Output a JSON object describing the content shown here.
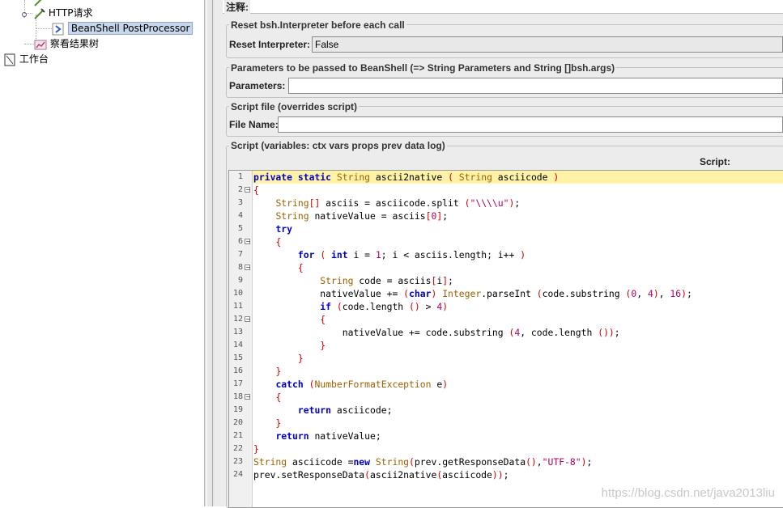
{
  "tree": {
    "items": [
      {
        "label": "HTTP请求"
      },
      {
        "label": "BeanShell PostProcessor",
        "selected": true
      },
      {
        "label": "察看结果树"
      },
      {
        "label": "工作台"
      }
    ]
  },
  "panel": {
    "comments_label": "注释:",
    "reset_section": {
      "legend": "Reset bsh.Interpreter before each call",
      "label": "Reset Interpreter:",
      "value": "False"
    },
    "params_section": {
      "legend": "Parameters to be passed to BeanShell (=> String Parameters and String []bsh.args)",
      "label": "Parameters:",
      "value": ""
    },
    "file_section": {
      "legend": "Script file (overrides script)",
      "label": "File Name:",
      "value": ""
    },
    "script_section": {
      "legend": "Script (variables: ctx vars props prev data log)",
      "script_label": "Script:"
    }
  },
  "script": {
    "lines": [
      "private static String ascii2native ( String asciicode )",
      "{",
      "    String[] asciis = asciicode.split (\"\\\\\\\\u\");",
      "    String nativeValue = asciis[0];",
      "    try",
      "    {",
      "        for ( int i = 1; i < asciis.length; i++ )",
      "        {",
      "            String code = asciis[i];",
      "            nativeValue += (char) Integer.parseInt (code.substring (0, 4), 16);",
      "            if (code.length () > 4)",
      "            {",
      "                nativeValue += code.substring (4, code.length ());",
      "            }",
      "        }",
      "    }",
      "    catch (NumberFormatException e)",
      "    {",
      "        return asciicode;",
      "    }",
      "    return nativeValue;",
      "}",
      "String asciicode =new String(prev.getResponseData(),\"UTF-8\");",
      "prev.setResponseData(ascii2native(asciicode));"
    ],
    "fold_lines": [
      2,
      6,
      8,
      12,
      18
    ],
    "highlight_line": 1
  },
  "watermark": "https://blog.csdn.net/java2013liu",
  "colors": {
    "keyword": "#0000c8",
    "type": "#a06000",
    "bracket": "#d00000",
    "string": "#b00060",
    "highlight": "#fff3a8",
    "selection": "#c7d6ea"
  },
  "icons": [
    "dropper-icon",
    "dropper-icon",
    "post-processor-icon",
    "result-tree-icon",
    "workbench-icon"
  ]
}
